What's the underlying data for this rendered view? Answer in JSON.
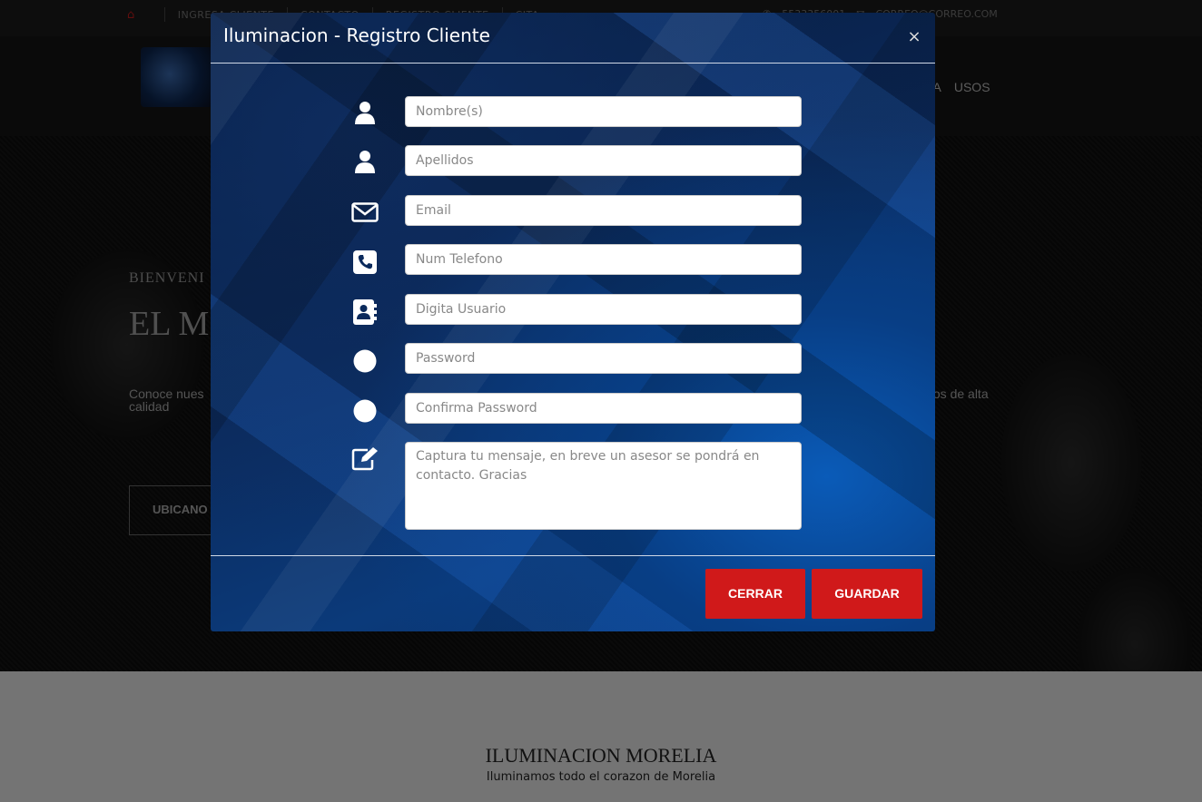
{
  "topbar": {
    "nav": [
      "INGRESA CLIENTE",
      "CONTACTO",
      "REGISTRO CLIENTE",
      "CITA"
    ],
    "phone": "5533356001",
    "email": "CORREO@CORREO.COM"
  },
  "header": {
    "menu": [
      "TA",
      "USOS"
    ]
  },
  "hero": {
    "welcome": "BIENVENI",
    "headline": "EL M",
    "desc_left": "Conoce nues",
    "desc_left_2": "calidad",
    "desc_right": "ctos de alta",
    "button": "UBICANO"
  },
  "footer": {
    "title": "ILUMINACION MORELIA",
    "subtitle": "Iluminamos todo el corazon de Morelia"
  },
  "modal": {
    "title": "Iluminacion - Registro Cliente",
    "close": "×",
    "fields": {
      "nombre": "Nombre(s)",
      "apellidos": "Apellidos",
      "email": "Email",
      "telefono": "Num Telefono",
      "usuario": "Digita Usuario",
      "password": "Password",
      "confirm": "Confirma Password",
      "mensaje": "Captura tu mensaje, en breve un asesor se pondrá en contacto. Gracias"
    },
    "buttons": {
      "cerrar": "CERRAR",
      "guardar": "GUARDAR"
    }
  },
  "colors": {
    "accent": "#d0191a",
    "modal_bg": "#0b2a5c"
  }
}
